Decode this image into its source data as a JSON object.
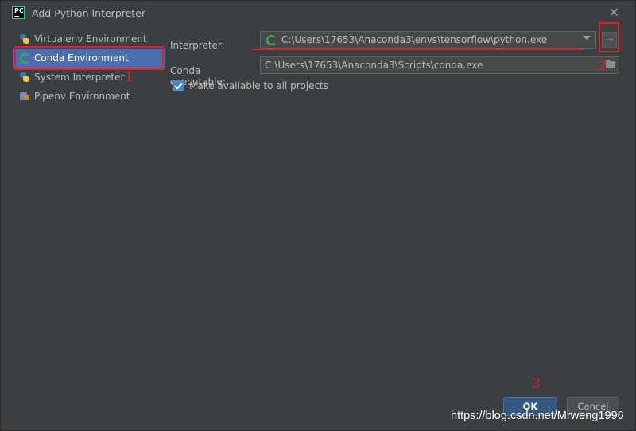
{
  "window": {
    "title": "Add Python Interpreter",
    "app_icon_text": "PC"
  },
  "sidebar": {
    "items": [
      {
        "label": "Virtualenv Environment",
        "icon": "python-icon"
      },
      {
        "label": "Conda Environment",
        "icon": "conda-icon",
        "selected": true
      },
      {
        "label": "System Interpreter",
        "icon": "python-icon"
      },
      {
        "label": "Pipenv Environment",
        "icon": "pipenv-icon"
      }
    ]
  },
  "form": {
    "interpreter_label": "Interpreter:",
    "interpreter_value": "C:\\Users\\17653\\Anaconda3\\envs\\tensorflow\\python.exe",
    "browse_label": "...",
    "conda_label": "Conda executable:",
    "conda_value": "C:\\Users\\17653\\Anaconda3\\Scripts\\conda.exe",
    "make_available_label": "Make available to all projects",
    "make_available_checked": true
  },
  "annotations": {
    "one": "1",
    "two": "2",
    "three": "3"
  },
  "buttons": {
    "ok": "OK",
    "cancel": "Cancel"
  },
  "watermark": "https://blog.csdn.net/Mrweng1996",
  "colors": {
    "accent": "#4b6eaf",
    "annotation": "#e0202a",
    "background": "#3c3f41",
    "ok_button": "#365880"
  }
}
